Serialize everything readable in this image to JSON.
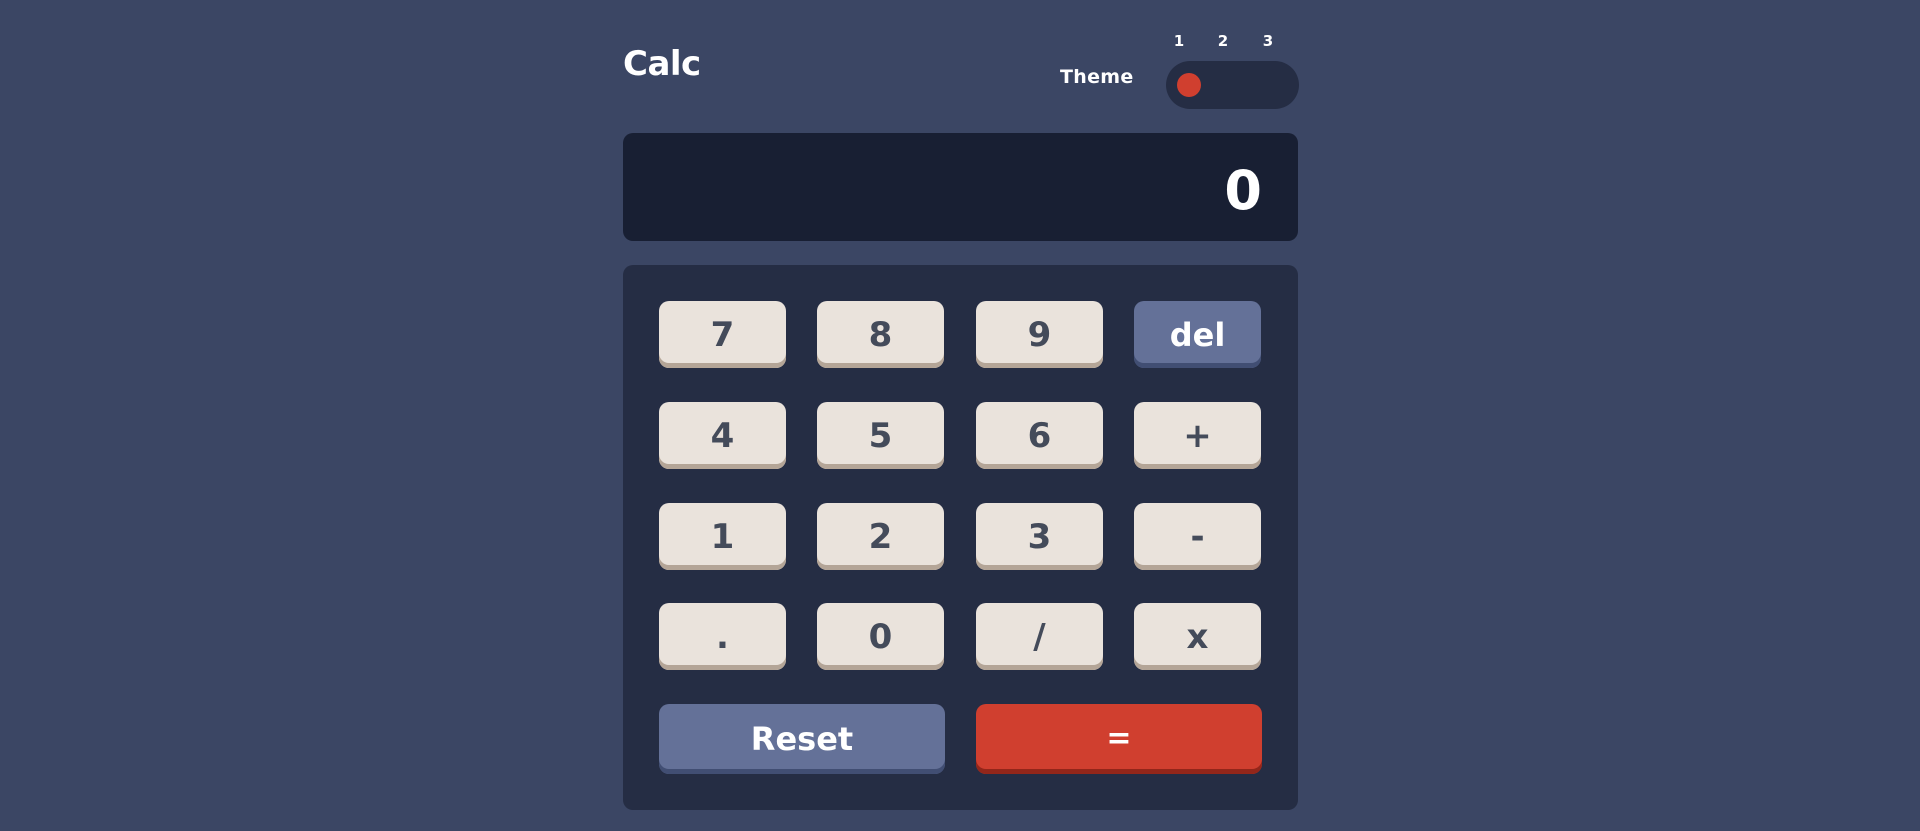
{
  "header": {
    "title": "Calc",
    "theme_label": "Theme",
    "theme_numbers": [
      "1",
      "2",
      "3"
    ],
    "theme_selected": 1
  },
  "display": {
    "value": "0"
  },
  "keypad": {
    "rows": [
      [
        "7",
        "8",
        "9",
        "del"
      ],
      [
        "4",
        "5",
        "6",
        "+"
      ],
      [
        "1",
        "2",
        "3",
        "-"
      ],
      [
        ".",
        "0",
        "/",
        "x"
      ]
    ],
    "reset_label": "Reset",
    "equals_label": "="
  },
  "colors": {
    "background": "#3b4664",
    "screen": "#181f33",
    "keypad": "#252d44",
    "key": "#eae3dc",
    "key_text": "#444b5a",
    "function_key": "#647198",
    "accent": "#d03f2f"
  }
}
